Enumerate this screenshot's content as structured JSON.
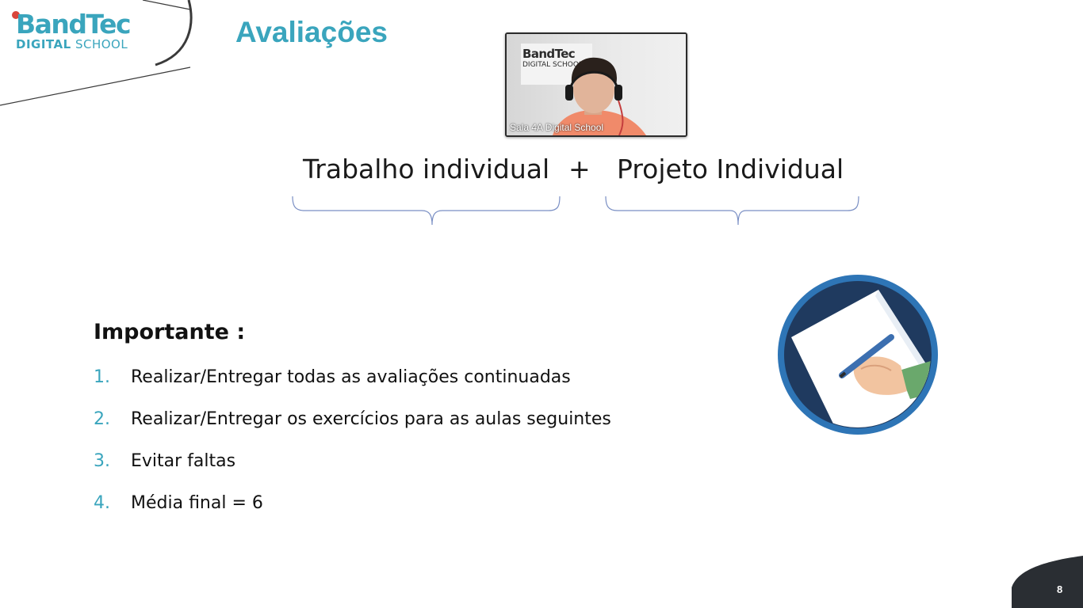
{
  "logo": {
    "line1": "BandTec",
    "line2_bold": "DIGITAL",
    "line2_light": "SCHOOL"
  },
  "slide": {
    "title": "Avaliações",
    "formula_left": "Trabalho individual",
    "formula_plus": "+",
    "formula_right": "Projeto Individual",
    "important_title": "Importante :",
    "items": [
      {
        "num": "1.",
        "text": "Realizar/Entregar todas as avaliações continuadas"
      },
      {
        "num": "2.",
        "text": "Realizar/Entregar os exercícios para as aulas seguintes"
      },
      {
        "num": "3.",
        "text": "Evitar faltas"
      },
      {
        "num": "4.",
        "text": "Média final = 6"
      }
    ],
    "page_number": "8"
  },
  "video": {
    "participant_name": "Sala 4A Digital School",
    "poster_line1": "BandTec",
    "poster_line2": "DIGITAL SCHOOL"
  },
  "colors": {
    "accent": "#3aa5bd",
    "text": "#111111",
    "dark_corner": "#2a2e33",
    "circle_blue": "#2e75b6",
    "circle_navy": "#1f3a5f"
  },
  "icons": {
    "illustration": "writing-hand-icon",
    "recording": "recording-dot-icon"
  }
}
